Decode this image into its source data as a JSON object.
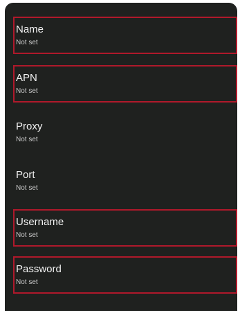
{
  "settings": {
    "items": [
      {
        "title": "Name",
        "subtitle": "Not set"
      },
      {
        "title": "APN",
        "subtitle": "Not set"
      },
      {
        "title": "Proxy",
        "subtitle": "Not set"
      },
      {
        "title": "Port",
        "subtitle": "Not set"
      },
      {
        "title": "Username",
        "subtitle": "Not set"
      },
      {
        "title": "Password",
        "subtitle": "Not set"
      }
    ]
  },
  "colors": {
    "background": "#1f211f",
    "highlight_border": "#b0192b",
    "title_text": "#f2f2f2",
    "subtitle_text": "#c9c9c9"
  }
}
